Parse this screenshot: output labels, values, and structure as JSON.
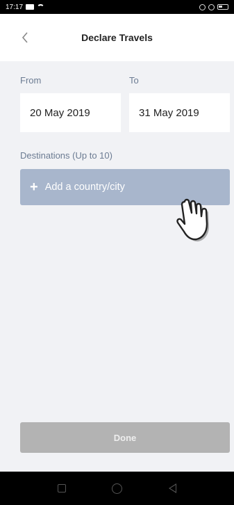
{
  "status_bar": {
    "time": "17:17"
  },
  "header": {
    "back_icon": "chevron-left-icon",
    "title": "Declare Travels"
  },
  "form": {
    "from_label": "From",
    "to_label": "To",
    "from_value": "20 May 2019",
    "to_value": "31 May 2019",
    "destinations_label": "Destinations (Up to 10)",
    "add_button": {
      "icon": "+",
      "label": "Add a country/city"
    }
  },
  "footer": {
    "done_label": "Done"
  },
  "colors": {
    "accent": "#a8b6cc",
    "label": "#6b7b92",
    "disabled_button": "#b3b3b3",
    "background": "#f1f2f5"
  }
}
